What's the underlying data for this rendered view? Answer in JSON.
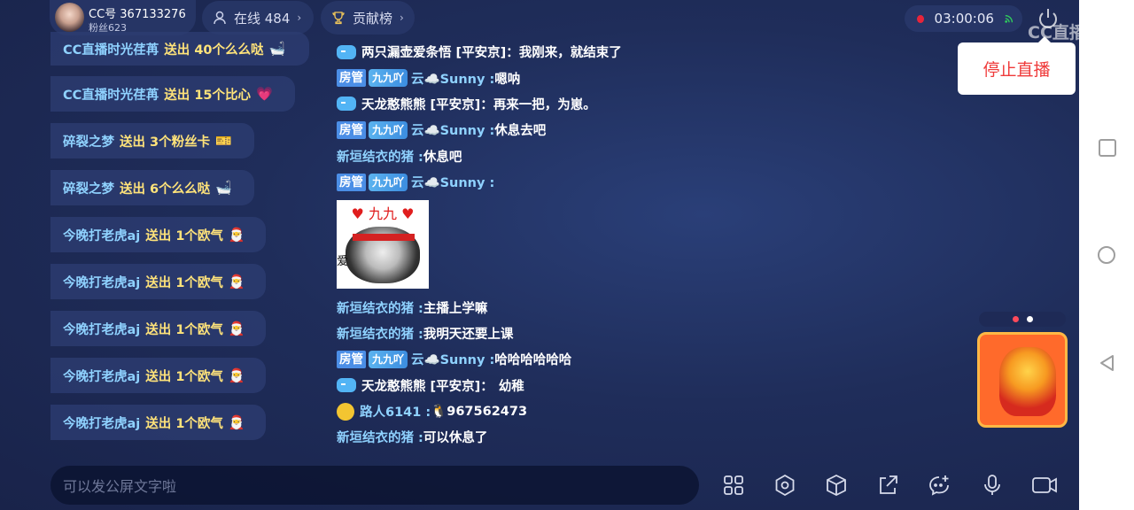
{
  "header": {
    "streamer_id": "CC号 367133276",
    "fans": "粉丝623",
    "online_label": "在线 484",
    "contribution_label": "贡献榜",
    "timer": "03:00:06",
    "logo_text": "CC直播",
    "stop_button": "停止直播"
  },
  "gifts": [
    {
      "name": "CC直播时光荏苒",
      "action": "送出 40个么么哒",
      "icon": "🛁"
    },
    {
      "name": "CC直播时光荏苒",
      "action": "送出 15个比心",
      "icon": "💗"
    },
    {
      "name": "碎裂之梦",
      "action": "送出 3个粉丝卡",
      "icon": "🎫"
    },
    {
      "name": "碎裂之梦",
      "action": "送出 6个么么哒",
      "icon": "🛁"
    },
    {
      "name": "今晚打老虎aj",
      "action": "送出 1个欧气",
      "icon": "🎅"
    },
    {
      "name": "今晚打老虎aj",
      "action": "送出 1个欧气",
      "icon": "🎅"
    },
    {
      "name": "今晚打老虎aj",
      "action": "送出 1个欧气",
      "icon": "🎅"
    },
    {
      "name": "今晚打老虎aj",
      "action": "送出 1个欧气",
      "icon": "🎅"
    },
    {
      "name": "今晚打老虎aj",
      "action": "送出 1个欧气",
      "icon": "🎅"
    }
  ],
  "chat": {
    "m0": {
      "user": "两只漏壶爱条悟 [平安京]：",
      "text": "我刚来，就结束了"
    },
    "m1": {
      "badge": "房管",
      "fan": "九九吖",
      "user": "云☁️Sunny : ",
      "text": "嗯呐"
    },
    "m2": {
      "user": "天龙憨熊熊 [平安京]：",
      "text": "再来一把，为崽。"
    },
    "m3": {
      "badge": "房管",
      "fan": "九九吖",
      "user": "云☁️Sunny : ",
      "text": "休息去吧"
    },
    "m4": {
      "user": "新垣结衣的猪 : ",
      "text": "休息吧"
    },
    "m5": {
      "badge": "房管",
      "fan": "九九吖",
      "user": "云☁️Sunny : ",
      "sticker_top": "九九",
      "sticker_side": "爱"
    },
    "m6": {
      "user": "新垣结衣的猪 : ",
      "text": "主播上学嘛"
    },
    "m7": {
      "user": "新垣结衣的猪 : ",
      "text": "我明天还要上课"
    },
    "m8": {
      "badge": "房管",
      "fan": "九九吖",
      "user": "云☁️Sunny : ",
      "text": "哈哈哈哈哈哈"
    },
    "m9": {
      "user": "天龙憨熊熊 [平安京]：",
      "text": "幼稚"
    },
    "m10": {
      "user": "路人6141 : ",
      "text": "🐧967562473"
    },
    "m11": {
      "user": "新垣结衣的猪 : ",
      "text": "可以休息了"
    }
  },
  "input": {
    "placeholder": "可以发公屏文字啦"
  },
  "icons": [
    "grid-icon",
    "settings-icon",
    "cube-icon",
    "share-icon",
    "emoji-add-icon",
    "mic-icon",
    "camera-icon"
  ],
  "colors": {
    "accent_blue": "#8fd2ff",
    "gift_yellow": "#ffe37a",
    "record_red": "#e8243a",
    "stop_red": "#ef3a3a"
  }
}
